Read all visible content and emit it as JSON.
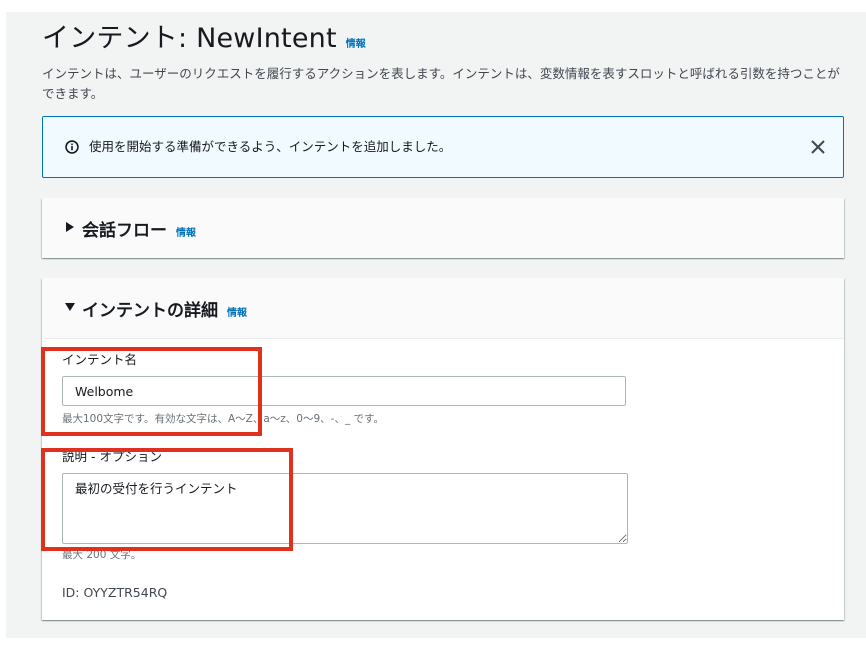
{
  "header": {
    "title": "インテント: NewIntent",
    "info_link": "情報",
    "description": "インテントは、ユーザーのリクエストを履行するアクションを表します。インテントは、変数情報を表すスロットと呼ばれる引数を持つことができます。"
  },
  "flash": {
    "icon": "info-icon",
    "message": "使用を開始する準備ができるよう、インテントを追加しました。",
    "close_icon": "close-icon"
  },
  "conversation_flow": {
    "title": "会話フロー",
    "info_link": "情報",
    "expanded": false
  },
  "intent_details": {
    "title": "インテントの詳細",
    "info_link": "情報",
    "expanded": true,
    "name_field": {
      "label": "インテント名",
      "value": "Welbome",
      "hint": "最大100文字です。有効な文字は、A～Z、a～z、0～9、-、_ です。"
    },
    "description_field": {
      "label": "説明 - オプション",
      "value": "最初の受付を行うインテント",
      "hint": "最大 200 文字。"
    },
    "id_text": "ID: OYYZTR54RQ"
  },
  "colors": {
    "link": "#0073bb",
    "flash_background": "#f1faff",
    "flash_border": "#0073bb",
    "highlight_box": "#e0301e",
    "page_background": "#f2f3f3"
  }
}
